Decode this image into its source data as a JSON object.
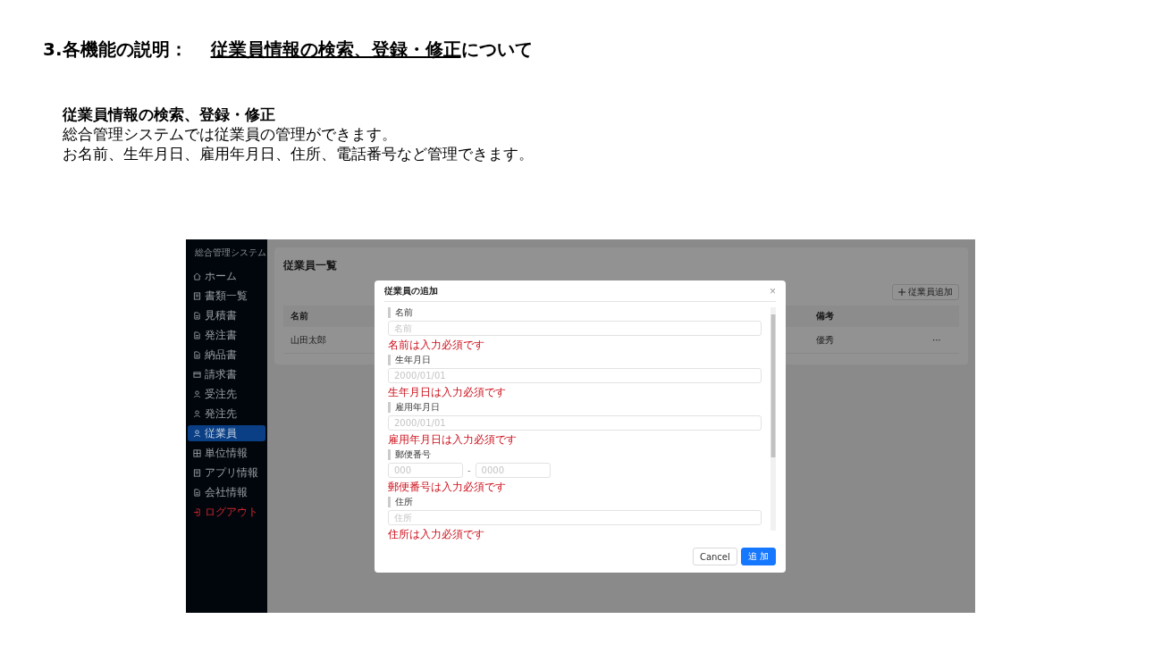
{
  "heading": {
    "number": "3.各機能の説明：",
    "topic": "従業員情報の検索、登録・修正",
    "suffix": "について"
  },
  "intro": {
    "title": "従業員情報の検索、登録・修正",
    "lines": [
      "総合管理システムでは従業員の管理ができます。",
      "お名前、生年月日、雇用年月日、住所、電話番号など管理できます。"
    ]
  },
  "app": {
    "sidebar": {
      "title": "総合管理システム",
      "items": [
        {
          "label": "ホーム",
          "kind": "home",
          "selected": false
        },
        {
          "label": "書類一覧",
          "kind": "list",
          "selected": false
        },
        {
          "label": "見積書",
          "kind": "doc",
          "selected": false
        },
        {
          "label": "発注書",
          "kind": "doc",
          "selected": false
        },
        {
          "label": "納品書",
          "kind": "doc",
          "selected": false
        },
        {
          "label": "請求書",
          "kind": "card",
          "selected": false
        },
        {
          "label": "受注先",
          "kind": "person",
          "selected": false
        },
        {
          "label": "発注先",
          "kind": "person",
          "selected": false
        },
        {
          "label": "従業員",
          "kind": "person",
          "selected": true
        },
        {
          "label": "単位情報",
          "kind": "grid",
          "selected": false
        },
        {
          "label": "アプリ情報",
          "kind": "list",
          "selected": false
        },
        {
          "label": "会社情報",
          "kind": "doc",
          "selected": false
        },
        {
          "label": "ログアウト",
          "kind": "logout",
          "selected": false
        }
      ]
    },
    "main": {
      "title": "従業員一覧",
      "add_button": "従業員追加",
      "table": {
        "columns": [
          "名前",
          "備考"
        ],
        "rows": [
          {
            "cells": [
              "山田太郎",
              "優秀"
            ],
            "menu": "···"
          }
        ]
      }
    },
    "dialog": {
      "title": "従業員の追加",
      "close": "×",
      "fields": [
        {
          "kind": "text",
          "label": "名前",
          "placeholder": "名前",
          "error": "名前は入力必須です"
        },
        {
          "kind": "text",
          "label": "生年月日",
          "placeholder": "2000/01/01",
          "error": "生年月日は入力必須です"
        },
        {
          "kind": "text",
          "label": "雇用年月日",
          "placeholder": "2000/01/01",
          "error": "雇用年月日は入力必須です"
        },
        {
          "kind": "postal",
          "label": "郵便番号",
          "placeholders": [
            "000",
            "0000"
          ],
          "separator": "-",
          "error": "郵便番号は入力必須です"
        },
        {
          "kind": "text",
          "label": "住所",
          "placeholder": "住所",
          "error": "住所は入力必須です"
        }
      ],
      "buttons": [
        {
          "label": "Cancel",
          "primary": false
        },
        {
          "label": "追 加",
          "primary": true
        }
      ]
    }
  }
}
